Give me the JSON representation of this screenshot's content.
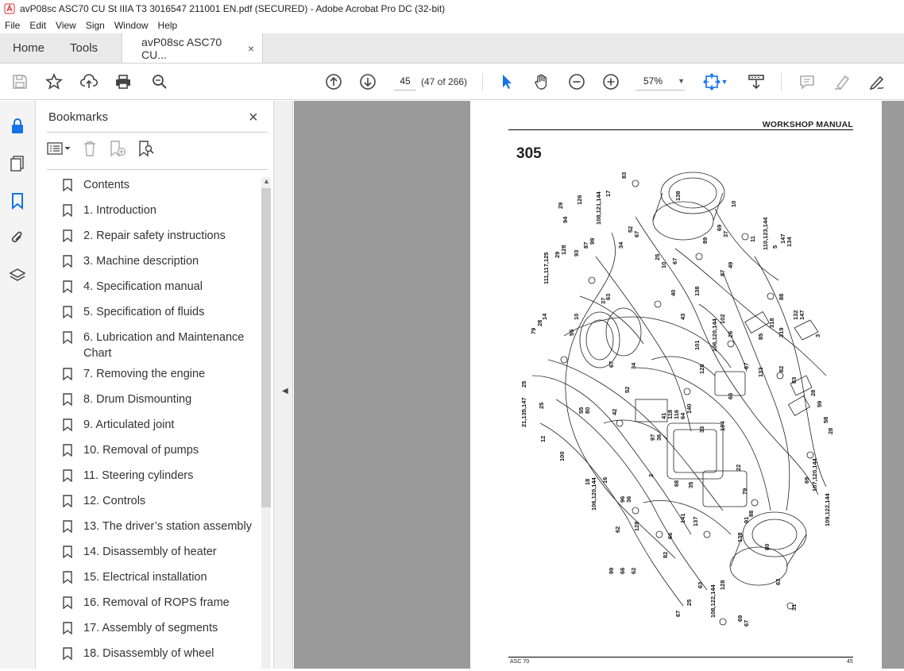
{
  "window": {
    "title": "avP08sc ASC70 CU St IIIA T3 3016547 211001 EN.pdf (SECURED) - Adobe Acrobat Pro DC (32-bit)"
  },
  "menu": [
    "File",
    "Edit",
    "View",
    "Sign",
    "Window",
    "Help"
  ],
  "tabs": {
    "home": "Home",
    "tools": "Tools",
    "document": "avP08sc ASC70 CU...",
    "close": "×"
  },
  "toolbar": {
    "page_number": "45",
    "page_count": "(47 of 266)",
    "zoom": "57%",
    "icons": [
      "save-icon",
      "bookmark-star-icon",
      "upload-icon",
      "print-icon",
      "zoom-search-icon",
      "page-up-icon",
      "page-down-icon",
      "select-arrow-icon",
      "hand-icon",
      "zoom-out-icon",
      "zoom-in-icon",
      "fit-page-icon",
      "scroll-mode-icon",
      "comment-icon",
      "highlight-icon",
      "sign-icon"
    ]
  },
  "panel": {
    "title": "Bookmarks",
    "close": "×",
    "bookmarks": [
      "Contents",
      "1. Introduction",
      "2. Repair safety instructions",
      "3. Machine description",
      "4. Specification manual",
      "5. Specification of fluids",
      "6. Lubrication and Maintenance Chart",
      "7. Removing the engine",
      "8. Drum Dismounting",
      "9. Articulated joint",
      "10. Removal of pumps",
      "11. Steering cylinders",
      "12. Controls",
      "13. The driver’s station assembly",
      "14. Disassembly of heater",
      "15. Electrical installation",
      "16. Removal of ROPS frame",
      "17. Assembly of segments",
      "18. Disassembly of wheel"
    ]
  },
  "page": {
    "header": "WORKSHOP MANUAL",
    "section_number": "305",
    "footer_left": "ASC 70",
    "footer_right": "45",
    "callouts": [
      "83",
      "17",
      "108,121,144",
      "126",
      "29",
      "94",
      "10",
      "138",
      "52",
      "67",
      "34",
      "99",
      "87",
      "93",
      "128",
      "29",
      "111,117,125",
      "25",
      "67",
      "89",
      "69",
      "37",
      "11",
      "110,123,144",
      "5",
      "147",
      "134",
      "49",
      "87",
      "40",
      "138",
      "10",
      "88",
      "43",
      "102",
      "318",
      "132",
      "147",
      "3",
      "319",
      "79",
      "28",
      "14",
      "10",
      "55",
      "37",
      "63",
      "67",
      "34",
      "101",
      "106,120,144",
      "26",
      "85",
      "67",
      "128",
      "82",
      "66",
      "133",
      "25",
      "21,135,147",
      "25",
      "12",
      "55",
      "80",
      "42",
      "52",
      "41",
      "118",
      "116",
      "64",
      "140",
      "104",
      "33",
      "83",
      "28",
      "59",
      "58",
      "28",
      "100",
      "97",
      "36",
      "18",
      "106,120,144",
      "16",
      "2",
      "68",
      "35",
      "22",
      "79",
      "96",
      "36",
      "62",
      "128",
      "137",
      "66",
      "141",
      "138",
      "91",
      "88",
      "69",
      "107,120,144",
      "109,122,144",
      "82",
      "99",
      "66",
      "62",
      "128",
      "25",
      "63",
      "67",
      "108,122,144",
      "80",
      "69",
      "67",
      "63",
      "31",
      "138"
    ]
  },
  "colors": {
    "doc_background": "#9a9a9a",
    "panel_background": "#ffffff",
    "accent_blue": "#1473e6"
  }
}
